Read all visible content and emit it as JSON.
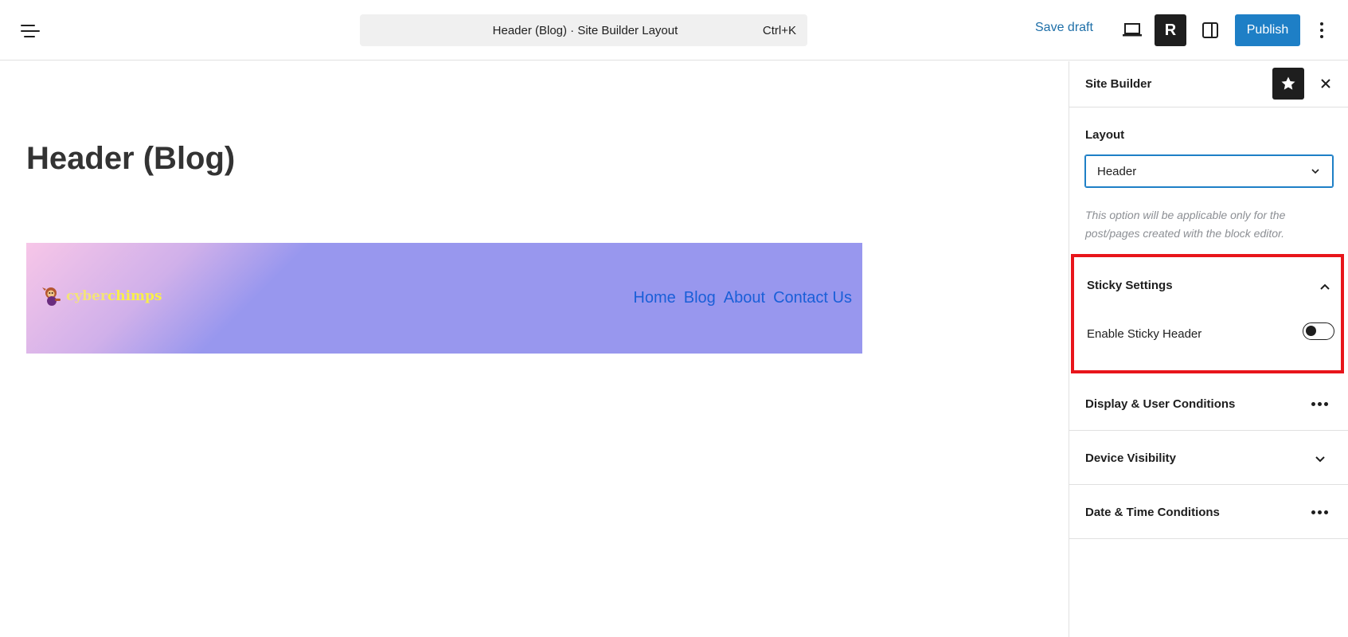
{
  "topbar": {
    "command_title": "Header (Blog) · Site Builder Layout",
    "command_shortcut": "Ctrl+K",
    "save_draft_label": "Save draft",
    "r_button_label": "R",
    "publish_label": "Publish"
  },
  "canvas": {
    "post_title": "Header (Blog)",
    "logo": {
      "text_part1": "cyber",
      "text_part2": "chimps"
    },
    "nav": [
      "Home",
      "Blog",
      "About",
      "Contact Us"
    ]
  },
  "sidebar": {
    "title": "Site Builder",
    "layout": {
      "label": "Layout",
      "selected": "Header",
      "help": "This option will be applicable only for the post/pages created with the block editor."
    },
    "sticky": {
      "title": "Sticky Settings",
      "enable_label": "Enable Sticky Header",
      "enabled": false
    },
    "panels": [
      {
        "title": "Display & User Conditions",
        "control": "more-icon"
      },
      {
        "title": "Device Visibility",
        "control": "chevron-down-icon"
      },
      {
        "title": "Date & Time Conditions",
        "control": "more-icon"
      }
    ]
  },
  "colors": {
    "accent": "#1e7fc6",
    "highlight_border": "#e8151b",
    "nav_link": "#1a5fd8",
    "banner_gradient_start": "#f7c6e8",
    "banner_main": "#9897ee"
  }
}
